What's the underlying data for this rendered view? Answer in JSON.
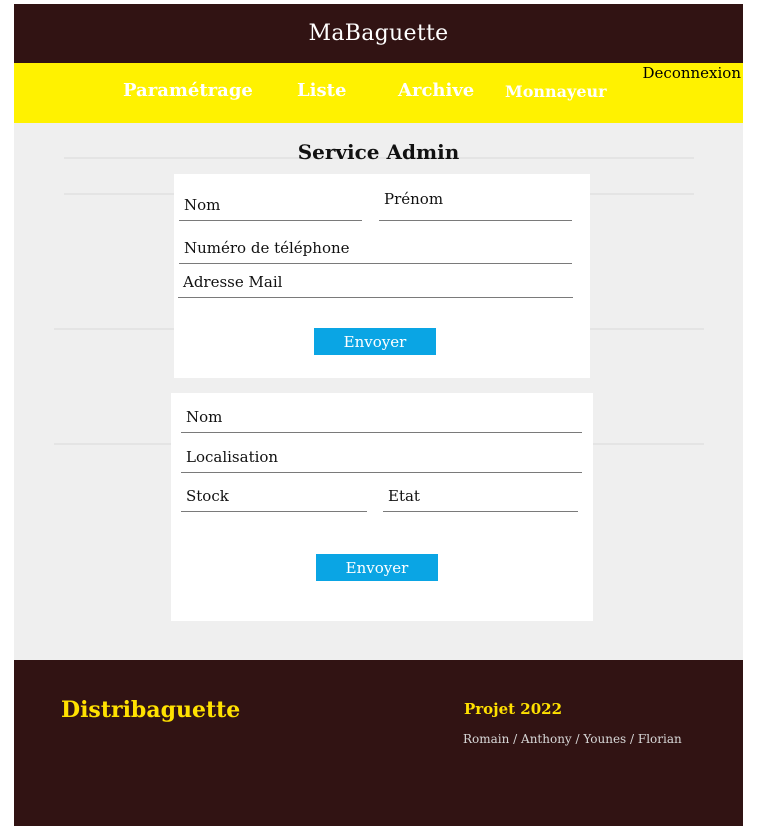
{
  "header": {
    "title": "MaBaguette"
  },
  "nav": {
    "items": [
      {
        "label": "Paramétrage"
      },
      {
        "label": "Liste"
      },
      {
        "label": "Archive"
      },
      {
        "label": "Monnayeur"
      }
    ],
    "logout_label": "Deconnexion"
  },
  "main": {
    "title": "Service Admin",
    "admin_form": {
      "nom_label": "Nom",
      "prenom_label": "Prénom",
      "telephone_label": "Numéro de téléphone",
      "email_label": "Adresse Mail",
      "submit_label": "Envoyer"
    },
    "machine_form": {
      "nom_label": "Nom",
      "localisation_label": "Localisation",
      "stock_label": "Stock",
      "etat_label": "Etat",
      "submit_label": "Envoyer"
    }
  },
  "footer": {
    "brand": "Distribaguette",
    "project": "Projet 2022",
    "authors": "Romain / Anthony / Younes / Florian"
  },
  "colors": {
    "header_bg": "#311313",
    "nav_bg": "#fff200",
    "button_bg": "#0aa5e4",
    "footer_accent": "#ffe100"
  }
}
